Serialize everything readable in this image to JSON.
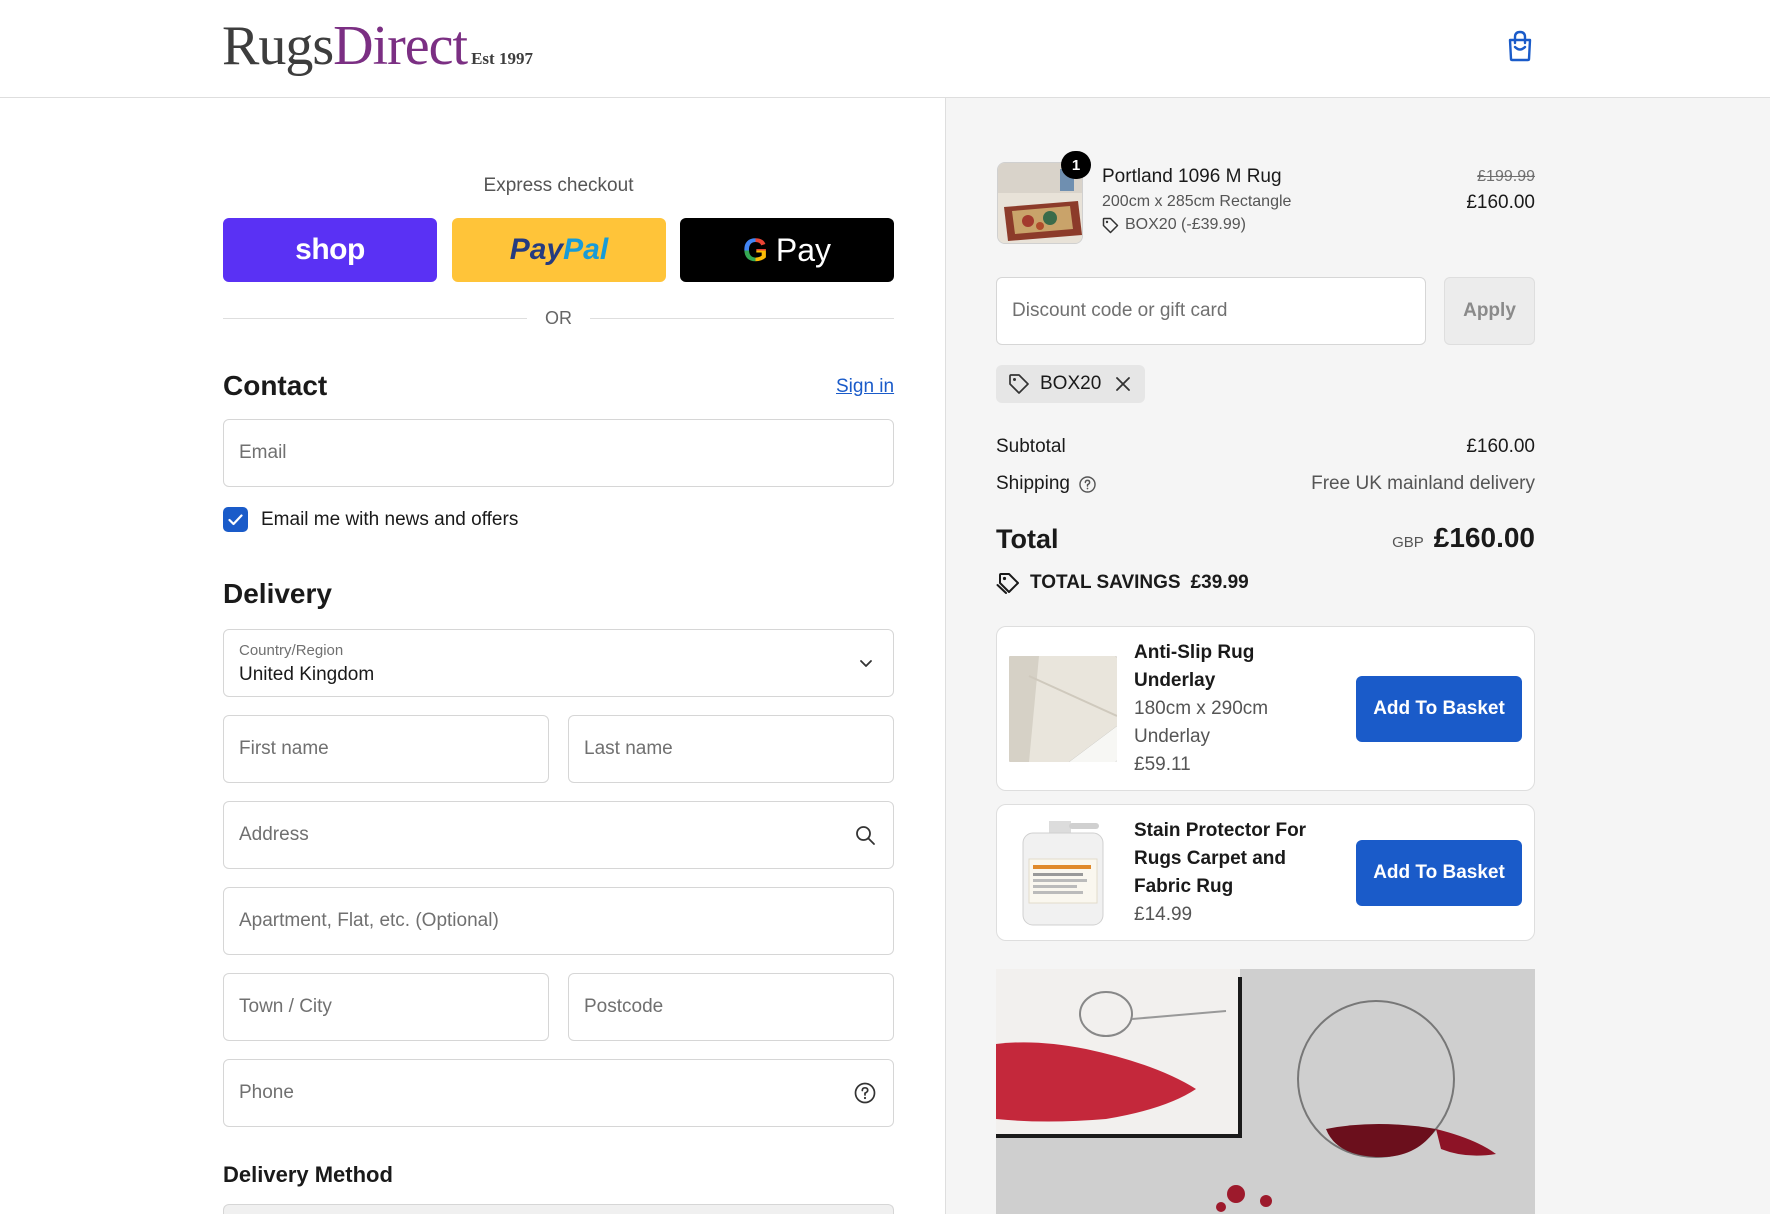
{
  "header": {
    "logo_rugs": "Rugs",
    "logo_direct": "Direct",
    "logo_est": "Est 1997",
    "cart_icon": "shopping-bag-icon"
  },
  "express": {
    "title": "Express checkout",
    "shop_label": "shop",
    "paypal_part1": "Pay",
    "paypal_part2": "Pal",
    "gpay_g": "G",
    "gpay_label": "Pay",
    "or_label": "OR"
  },
  "contact": {
    "title": "Contact",
    "sign_in": "Sign in",
    "email_placeholder": "Email",
    "newsletter_label": "Email me with news and offers",
    "newsletter_checked": true
  },
  "delivery": {
    "title": "Delivery",
    "country_label": "Country/Region",
    "country_value": "United Kingdom",
    "first_name": "First name",
    "last_name": "Last name",
    "address": "Address",
    "apartment": "Apartment, Flat, etc. (Optional)",
    "city": "Town / City",
    "postcode": "Postcode",
    "phone": "Phone",
    "method_title": "Delivery Method"
  },
  "order": {
    "item": {
      "quantity": "1",
      "name": "Portland 1096 M Rug",
      "variant": "200cm x 285cm Rectangle",
      "discount": "BOX20 (-£39.99)",
      "price_old": "£199.99",
      "price_new": "£160.00"
    },
    "discount_placeholder": "Discount code or gift card",
    "apply_label": "Apply",
    "applied_code": "BOX20",
    "subtotal_label": "Subtotal",
    "subtotal_value": "£160.00",
    "shipping_label": "Shipping",
    "shipping_value": "Free UK mainland delivery",
    "total_label": "Total",
    "total_currency": "GBP",
    "total_value": "£160.00",
    "savings_label": "TOTAL SAVINGS",
    "savings_value": "£39.99"
  },
  "upsells": [
    {
      "name_line1": "Anti-Slip Rug",
      "name_line2": "Underlay",
      "desc_line1": "180cm x 290cm",
      "desc_line2": "Underlay",
      "price": "£59.11",
      "button": "Add To Basket"
    },
    {
      "name_line1": "Stain Protector For",
      "name_line2": "Rugs Carpet and",
      "name_line3": "Fabric Rug",
      "price": "£14.99",
      "button": "Add To Basket"
    }
  ],
  "colors": {
    "accent": "#1a5bc9",
    "shop": "#5a31f4",
    "paypal": "#ffc439",
    "brand_purple": "#7b2f83"
  }
}
